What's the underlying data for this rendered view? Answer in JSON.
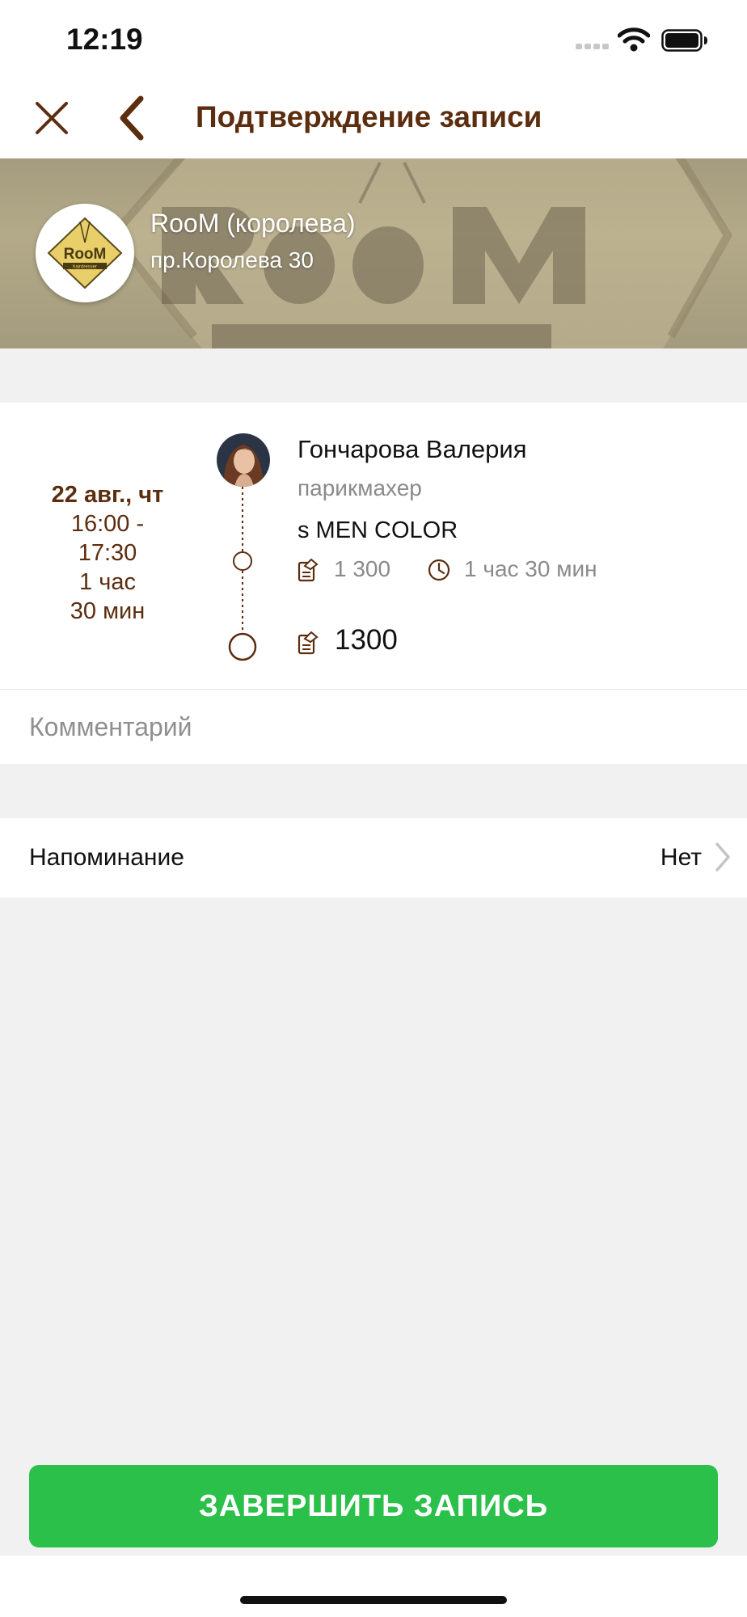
{
  "status_bar": {
    "time": "12:19"
  },
  "nav": {
    "title": "Подтверждение записи"
  },
  "salon": {
    "name": "RooM (королева)",
    "address": "пр.Королева 30",
    "logo_text": "RooM",
    "logo_subtext": "hairdresser"
  },
  "booking": {
    "date": "22 авг., чт",
    "time_range_start": "16:00 -",
    "time_range_end": "17:30",
    "duration_line1": "1 час",
    "duration_line2": "30 мин",
    "master_name": "Гончарова Валерия",
    "master_role": "парикмахер",
    "service_name": "s MEN COLOR",
    "service_price": "1 300",
    "service_duration": "1 час 30 мин",
    "total": "1300"
  },
  "comment": {
    "placeholder": "Комментарий"
  },
  "reminder": {
    "label": "Напоминание",
    "value": "Нет"
  },
  "actions": {
    "finish_label": "ЗАВЕРШИТЬ ЗАПИСЬ"
  },
  "colors": {
    "accent_brown": "#5c2d0e",
    "finish_green": "#2ac04a",
    "background": "#f1f1f1"
  }
}
